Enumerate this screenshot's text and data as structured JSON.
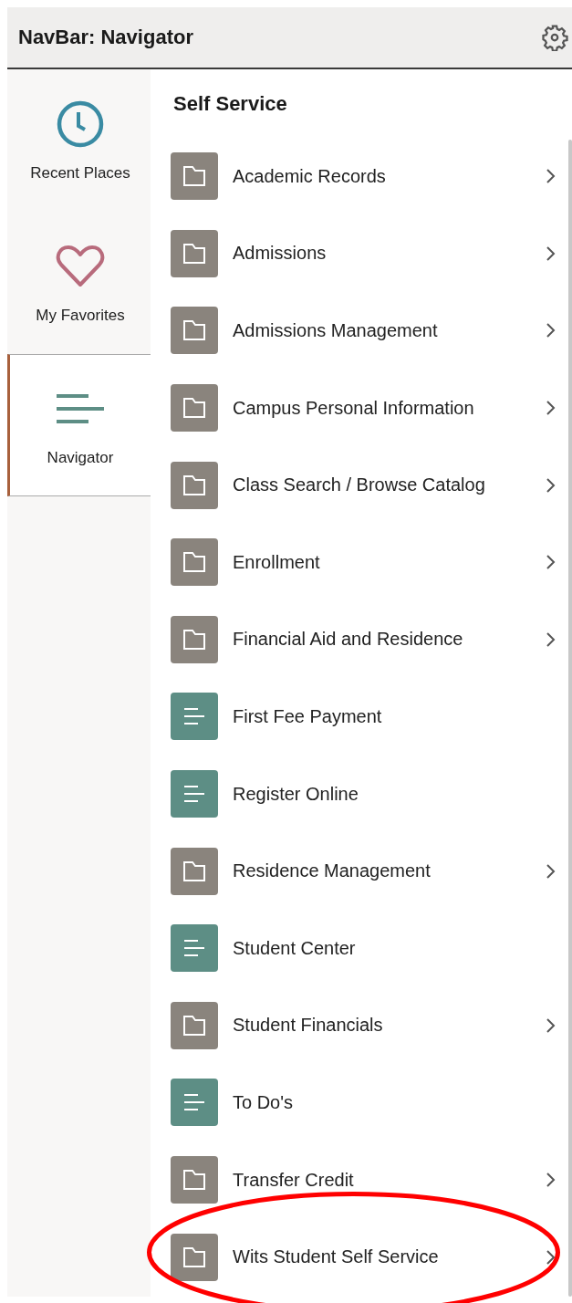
{
  "header": {
    "title": "NavBar: Navigator"
  },
  "sidebar": {
    "items": [
      {
        "label": "Recent Places",
        "kind": "recent",
        "selected": false
      },
      {
        "label": "My Favorites",
        "kind": "favorites",
        "selected": false
      },
      {
        "label": "Navigator",
        "kind": "navigator",
        "selected": true
      }
    ]
  },
  "panel": {
    "title": "Self Service",
    "items": [
      {
        "label": "Academic Records",
        "kind": "folder",
        "circled": false
      },
      {
        "label": "Admissions",
        "kind": "folder",
        "circled": false
      },
      {
        "label": "Admissions Management",
        "kind": "folder",
        "circled": false
      },
      {
        "label": "Campus Personal Information",
        "kind": "folder",
        "circled": false
      },
      {
        "label": "Class Search / Browse Catalog",
        "kind": "folder",
        "circled": false
      },
      {
        "label": "Enrollment",
        "kind": "folder",
        "circled": false
      },
      {
        "label": "Financial Aid and Residence",
        "kind": "folder",
        "circled": false
      },
      {
        "label": "First Fee Payment",
        "kind": "page",
        "circled": false
      },
      {
        "label": "Register Online",
        "kind": "page",
        "circled": false
      },
      {
        "label": "Residence Management",
        "kind": "folder",
        "circled": false
      },
      {
        "label": "Student Center",
        "kind": "page",
        "circled": false
      },
      {
        "label": "Student Financials",
        "kind": "folder",
        "circled": false
      },
      {
        "label": "To Do's",
        "kind": "page",
        "circled": false
      },
      {
        "label": "Transfer Credit",
        "kind": "folder",
        "circled": false
      },
      {
        "label": "Wits Student Self Service",
        "kind": "folder",
        "circled": true
      }
    ]
  }
}
